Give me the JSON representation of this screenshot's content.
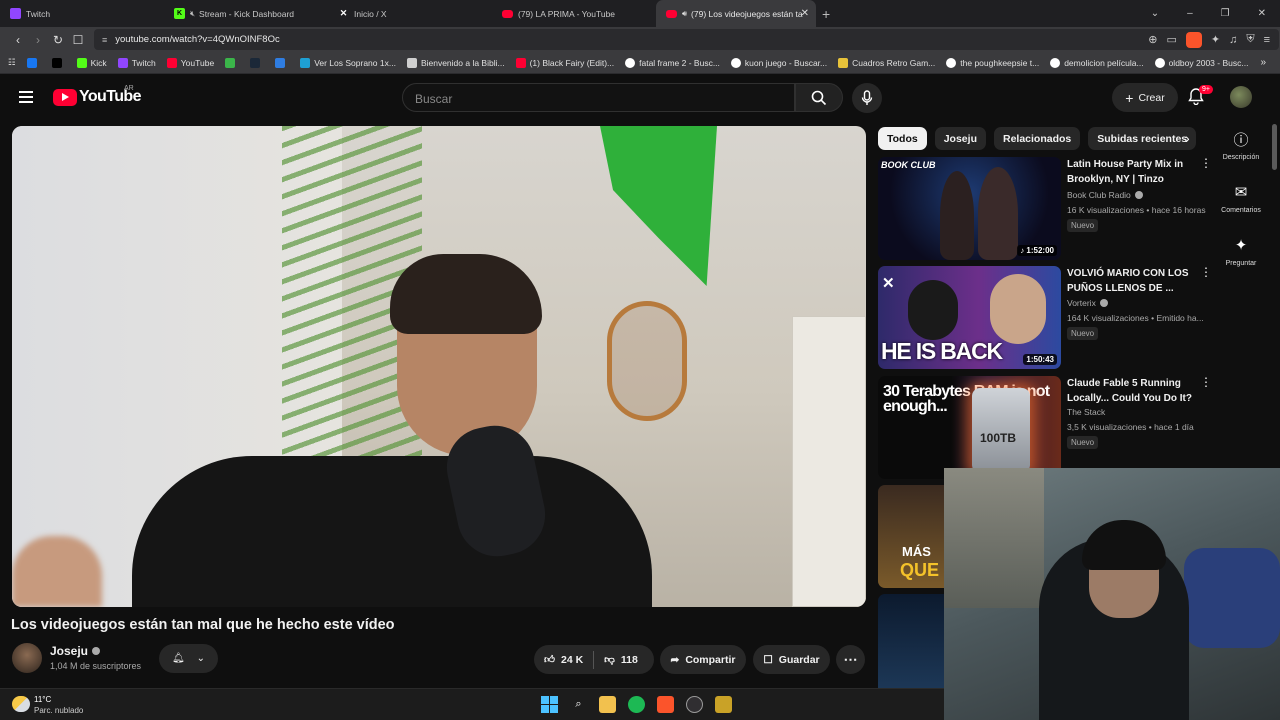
{
  "tabs": [
    {
      "label": "Twitch",
      "fav": "twitch",
      "active": false
    },
    {
      "label": "Stream - Kick Dashboard",
      "fav": "kick",
      "active": false
    },
    {
      "label": "Inicio / X",
      "fav": "x",
      "active": false
    },
    {
      "label": "(79) LA PRIMA - YouTube",
      "fav": "yt",
      "active": false
    },
    {
      "label": "(79) Los videojuegos están ta",
      "fav": "yt",
      "active": true
    }
  ],
  "url": "youtube.com/watch?v=4QWnOINF8Oc",
  "bookmarks": [
    {
      "label": "",
      "icon": "facebook-icon",
      "color": "#1877f2"
    },
    {
      "label": "",
      "icon": "x-icon",
      "color": "#000000"
    },
    {
      "label": "Kick",
      "icon": "kick-icon",
      "color": "#53fc18"
    },
    {
      "label": "Twitch",
      "icon": "twitch-icon",
      "color": "#9146ff"
    },
    {
      "label": "YouTube",
      "icon": "youtube-icon",
      "color": "#ff0033"
    },
    {
      "label": "",
      "icon": "game-icon",
      "color": "#3bb54a"
    },
    {
      "label": "",
      "icon": "steam-icon",
      "color": "#1b2838"
    },
    {
      "label": "",
      "icon": "cloud-icon",
      "color": "#2f7de1"
    },
    {
      "label": "Ver Los Soprano 1x...",
      "icon": "play-icon",
      "color": "#1ea0d4"
    },
    {
      "label": "Bienvenido a la Bibli...",
      "icon": "book-icon",
      "color": "#cfcfcf"
    },
    {
      "label": "(1) Black Fairy (Edit)...",
      "icon": "youtube-icon",
      "color": "#ff0033"
    },
    {
      "label": "fatal frame 2 - Busc...",
      "icon": "google-icon",
      "color": "#ffffff"
    },
    {
      "label": "kuon juego - Buscar...",
      "icon": "google-icon",
      "color": "#ffffff"
    },
    {
      "label": "Cuadros Retro Gam...",
      "icon": "store-icon",
      "color": "#e8c33a"
    },
    {
      "label": "the poughkeepsie t...",
      "icon": "google-icon",
      "color": "#ffffff"
    },
    {
      "label": "demolicion película...",
      "icon": "google-icon",
      "color": "#ffffff"
    },
    {
      "label": "oldboy 2003 - Busc...",
      "icon": "google-icon",
      "color": "#ffffff"
    }
  ],
  "yt": {
    "logo": "YouTube",
    "country": "AR",
    "search_placeholder": "Buscar",
    "create_label": "Crear",
    "notif_count": "9+"
  },
  "video": {
    "title": "Los videojuegos están tan mal que he hecho este vídeo",
    "channel": "Joseju",
    "subscribers": "1,04 M de suscriptores",
    "likes": "24 K",
    "dislikes": "118",
    "share_label": "Compartir",
    "save_label": "Guardar"
  },
  "chips": [
    "Todos",
    "Joseju",
    "Relacionados",
    "Subidas recientes"
  ],
  "rail": [
    {
      "label": "Descripción",
      "icon": "info-icon"
    },
    {
      "label": "Comentarios",
      "icon": "comment-icon"
    },
    {
      "label": "Preguntar",
      "icon": "sparkle-icon"
    }
  ],
  "recs": [
    {
      "title": "Latin House Party Mix in Brooklyn, NY | Tinzo",
      "channel": "Book Club Radio",
      "verified": true,
      "meta": "16 K visualizaciones • hace 16 horas",
      "badge": "Nuevo",
      "duration": "1:52:00",
      "thumb_text": "BOOK CLUB"
    },
    {
      "title": "VOLVIÓ MARIO CON LOS PUÑOS LLENOS DE ...",
      "channel": "Vorterix",
      "verified": true,
      "meta": "164 K visualizaciones • Emitido ha...",
      "badge": "Nuevo",
      "duration": "1:50:43",
      "thumb_text": "HE IS BACK"
    },
    {
      "title": "Claude Fable 5 Running Locally... Could You Do It?",
      "channel": "The Stack",
      "verified": false,
      "meta": "3,5 K visualizaciones • hace 1 día",
      "badge": "Nuevo",
      "duration": "",
      "thumb_text": "30 Terabytes RAM is not enough...",
      "thumb_box": "100TB"
    },
    {
      "title": "",
      "channel": "",
      "verified": false,
      "meta": "",
      "badge": "",
      "duration": "",
      "thumb_text": "MÁS",
      "thumb_text2": "QUE"
    },
    {
      "title": "",
      "channel": "",
      "verified": false,
      "meta": "",
      "badge": "",
      "duration": "",
      "thumb_text": ""
    }
  ],
  "taskbar": {
    "temp": "11°C",
    "weather": "Parc. nublado",
    "apps": [
      "windows-icon",
      "search-icon",
      "folder-icon",
      "spotify-icon",
      "brave-icon",
      "obs-icon",
      "app-icon"
    ]
  }
}
